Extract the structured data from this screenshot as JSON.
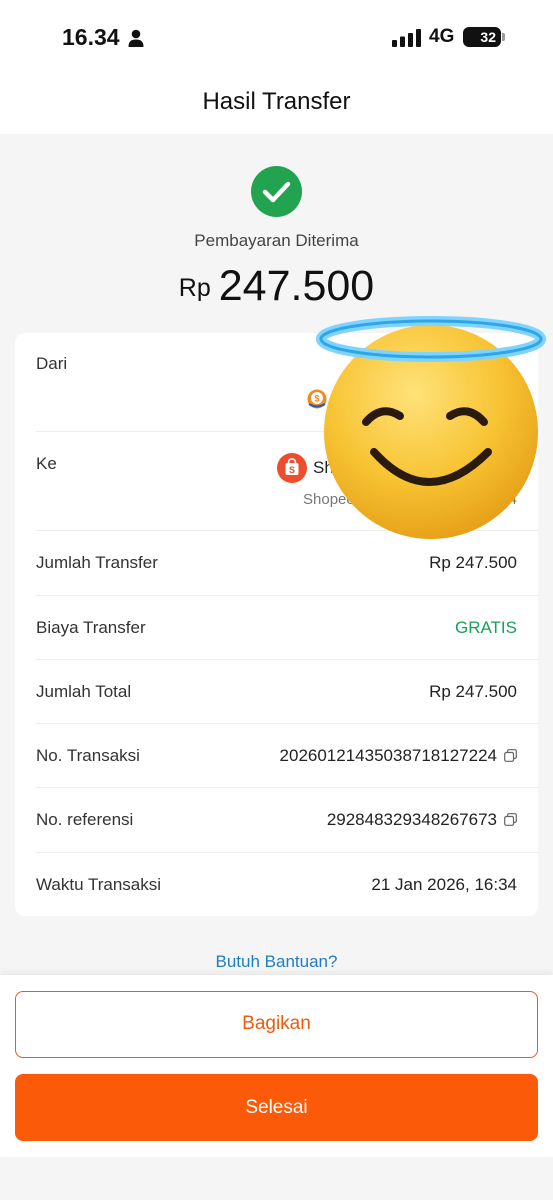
{
  "status_bar": {
    "time": "16.34",
    "network": "4G",
    "battery": "32"
  },
  "header": {
    "title": "Hasil Transfer"
  },
  "summary": {
    "status": "Pembayaran Diterima",
    "currency": "Rp",
    "amount": "247.500",
    "accent_color": "#22a350"
  },
  "details": {
    "from_label": "Dari",
    "to_label": "Ke",
    "to_name": "Sh",
    "to_sub": "Shopee",
    "to_sub_tail": "4",
    "rows": [
      {
        "label": "Jumlah Transfer",
        "value": "Rp 247.500"
      },
      {
        "label": "Biaya Transfer",
        "value": "GRATIS"
      },
      {
        "label": "Jumlah Total",
        "value": "Rp 247.500"
      },
      {
        "label": "No. Transaksi",
        "value": "20260121435038718127224"
      },
      {
        "label": "No. referensi",
        "value": "292848329348267673"
      },
      {
        "label": "Waktu Transaksi",
        "value": "21 Jan 2026, 16:34"
      }
    ]
  },
  "help_link": "Butuh Bantuan?",
  "actions": {
    "share_label": "Bagikan",
    "done_label": "Selesai",
    "brand_color": "#fb5a08"
  },
  "icons": {
    "status": [
      "person-icon",
      "signal-icon",
      "battery-icon"
    ],
    "summary": "check-circle-icon",
    "copy": "copy-icon",
    "sticker": "smiling-face-with-halo-emoji"
  }
}
